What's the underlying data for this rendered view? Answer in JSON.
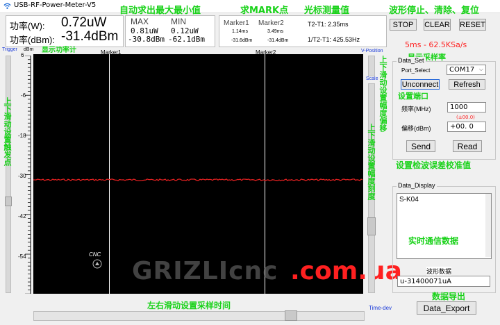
{
  "app": {
    "title": "USB-RF-Power-Meter-V5"
  },
  "power": {
    "w_label": "功率(W):",
    "w_value": "0.72uW",
    "dbm_label": "功率(dBm):",
    "dbm_value": "-31.4dBm"
  },
  "maxmin": {
    "max_label": "MAX",
    "min_label": "MIN",
    "max_w": "0.81uW",
    "max_dbm": "-30.8dBm",
    "min_w": "0.12uW",
    "min_dbm": "-62.1dBm"
  },
  "markers": {
    "m1_label": "Marker1",
    "m2_label": "Marker2",
    "m1_time": "1.14ms",
    "m1_dbm": "-31.6dBm",
    "m2_time": "3.49ms",
    "m2_dbm": "-31.4dBm",
    "dt": "T2-T1: 2.35ms",
    "inv_dt": "1/T2-T1: 425.53Hz"
  },
  "wave_buttons": {
    "stop": "STOP",
    "clear": "CLEAR",
    "reset": "RESET"
  },
  "annotations": {
    "auto_maxmin": "自动求出最大最小值",
    "find_mark": "求MARK点",
    "cursor_measure": "光标测量值",
    "wave_ctrl": "波形停止、清除、复位",
    "show_power": "显示功率计",
    "sample_rate": "5ms - 62.5KSa/s",
    "show_sample": "显示采样率",
    "set_port": "设置端口",
    "left_trigger": "上下滑动设置触发点",
    "right_offset": "上下滑动设置幅度偏移",
    "right_scale": "上下滑动设置幅度刻度",
    "set_cal": "设置检波误差校准值",
    "realtime": "实时通信数据",
    "bottom_time": "左右滑动设置采样时间",
    "data_export_note": "数据导出",
    "watermark": "GRIZLIcnc",
    "watermark2": ".com.ua",
    "cnc": "CNC"
  },
  "plot": {
    "trigger_label": "Trigger",
    "dbm_unit": "dBm",
    "vpos_label": "V-Position",
    "scale_label": "Scale",
    "timedev_label": "Time-dev",
    "marker1": "Marker1",
    "marker2": "Marker2",
    "y_ticks": [
      "6",
      "-6",
      "-18",
      "-30",
      "-42",
      "-54"
    ]
  },
  "dataset": {
    "title": "Data_Set",
    "port_label": "Port_Select",
    "port_value": "COM17",
    "unconnect": "Unconnect",
    "refresh": "Refresh",
    "freq_label": "频率(MHz)",
    "freq_value": "1000",
    "freq_tol": "(±00.0)",
    "offset_label": "偏移(dBm)",
    "offset_value": "+00. 0",
    "send": "Send",
    "read": "Read"
  },
  "display": {
    "title": "Data_Display",
    "content": "S-K04",
    "wave_label": "波形数据",
    "wave_value": "u-31400071uA",
    "export": "Data_Export"
  },
  "colors": {
    "trace": "#e02020",
    "annotation": "#19d219",
    "accent_red": "#ff2020"
  }
}
